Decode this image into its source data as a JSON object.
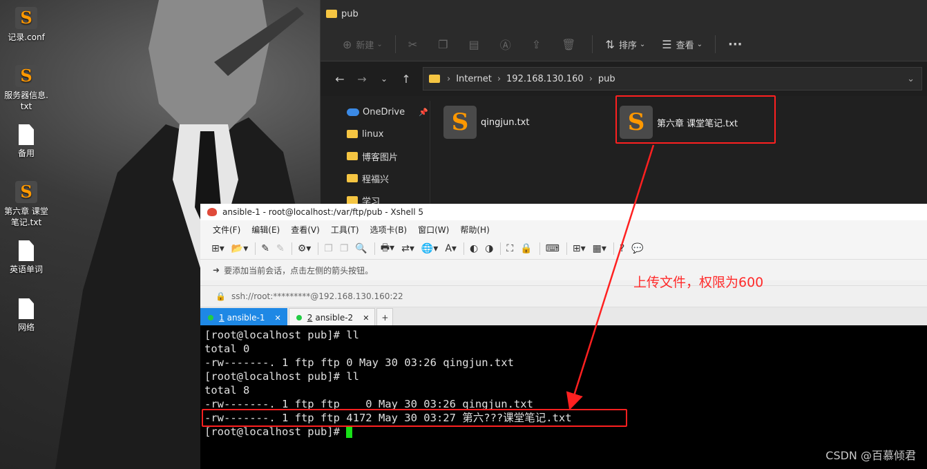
{
  "desktop": {
    "icons": [
      {
        "label": "记录.conf",
        "icon": "sublime-text-icon"
      },
      {
        "label": "服务器信息.txt",
        "icon": "sublime-text-icon"
      },
      {
        "label": "备用",
        "icon": "document-icon"
      },
      {
        "label": "第六章 课堂笔记.txt",
        "icon": "sublime-text-icon"
      },
      {
        "label": "英语单词",
        "icon": "document-icon"
      },
      {
        "label": "网络",
        "icon": "document-icon"
      }
    ]
  },
  "explorer": {
    "title": "pub",
    "toolbar": {
      "new_label": "新建",
      "sort_label": "排序",
      "view_label": "查看",
      "more_label": "···"
    },
    "address": {
      "segments": [
        "Internet",
        "192.168.130.160",
        "pub"
      ]
    },
    "nav": [
      {
        "label": "OneDrive",
        "icon": "cloud-icon"
      },
      {
        "label": "linux",
        "icon": "folder-icon"
      },
      {
        "label": "博客图片",
        "icon": "folder-icon"
      },
      {
        "label": "程福兴",
        "icon": "folder-icon"
      },
      {
        "label": "学习",
        "icon": "folder-icon"
      }
    ],
    "files": [
      {
        "name": "qingjun.txt",
        "icon": "sublime-text-icon"
      },
      {
        "name": "第六章 课堂笔记.txt",
        "icon": "sublime-text-icon"
      }
    ]
  },
  "xshell": {
    "title": "ansible-1 - root@localhost:/var/ftp/pub - Xshell 5",
    "menu": [
      "文件(F)",
      "编辑(E)",
      "查看(V)",
      "工具(T)",
      "选项卡(B)",
      "窗口(W)",
      "帮助(H)"
    ],
    "hint": "要添加当前会话，点击左侧的箭头按钮。",
    "address": "ssh://root:*********@192.168.130.160:22",
    "tabs": [
      {
        "num": "1",
        "label": "ansible-1",
        "active": true
      },
      {
        "num": "2",
        "label": "ansible-2",
        "active": false
      }
    ],
    "terminal_lines": [
      "[root@localhost pub]# ll",
      "total 0",
      "-rw-------. 1 ftp ftp 0 May 30 03:26 qingjun.txt",
      "[root@localhost pub]# ll",
      "total 8",
      "-rw-------. 1 ftp ftp    0 May 30 03:26 qingjun.txt",
      "-rw-------. 1 ftp ftp 4172 May 30 03:27 第六???课堂笔记.txt",
      "[root@localhost pub]# "
    ],
    "cursor_color": "#18e018"
  },
  "annotation": {
    "text": "上传文件，权限为600",
    "color": "#ff2a2a"
  },
  "watermark": "CSDN @百慕倾君"
}
